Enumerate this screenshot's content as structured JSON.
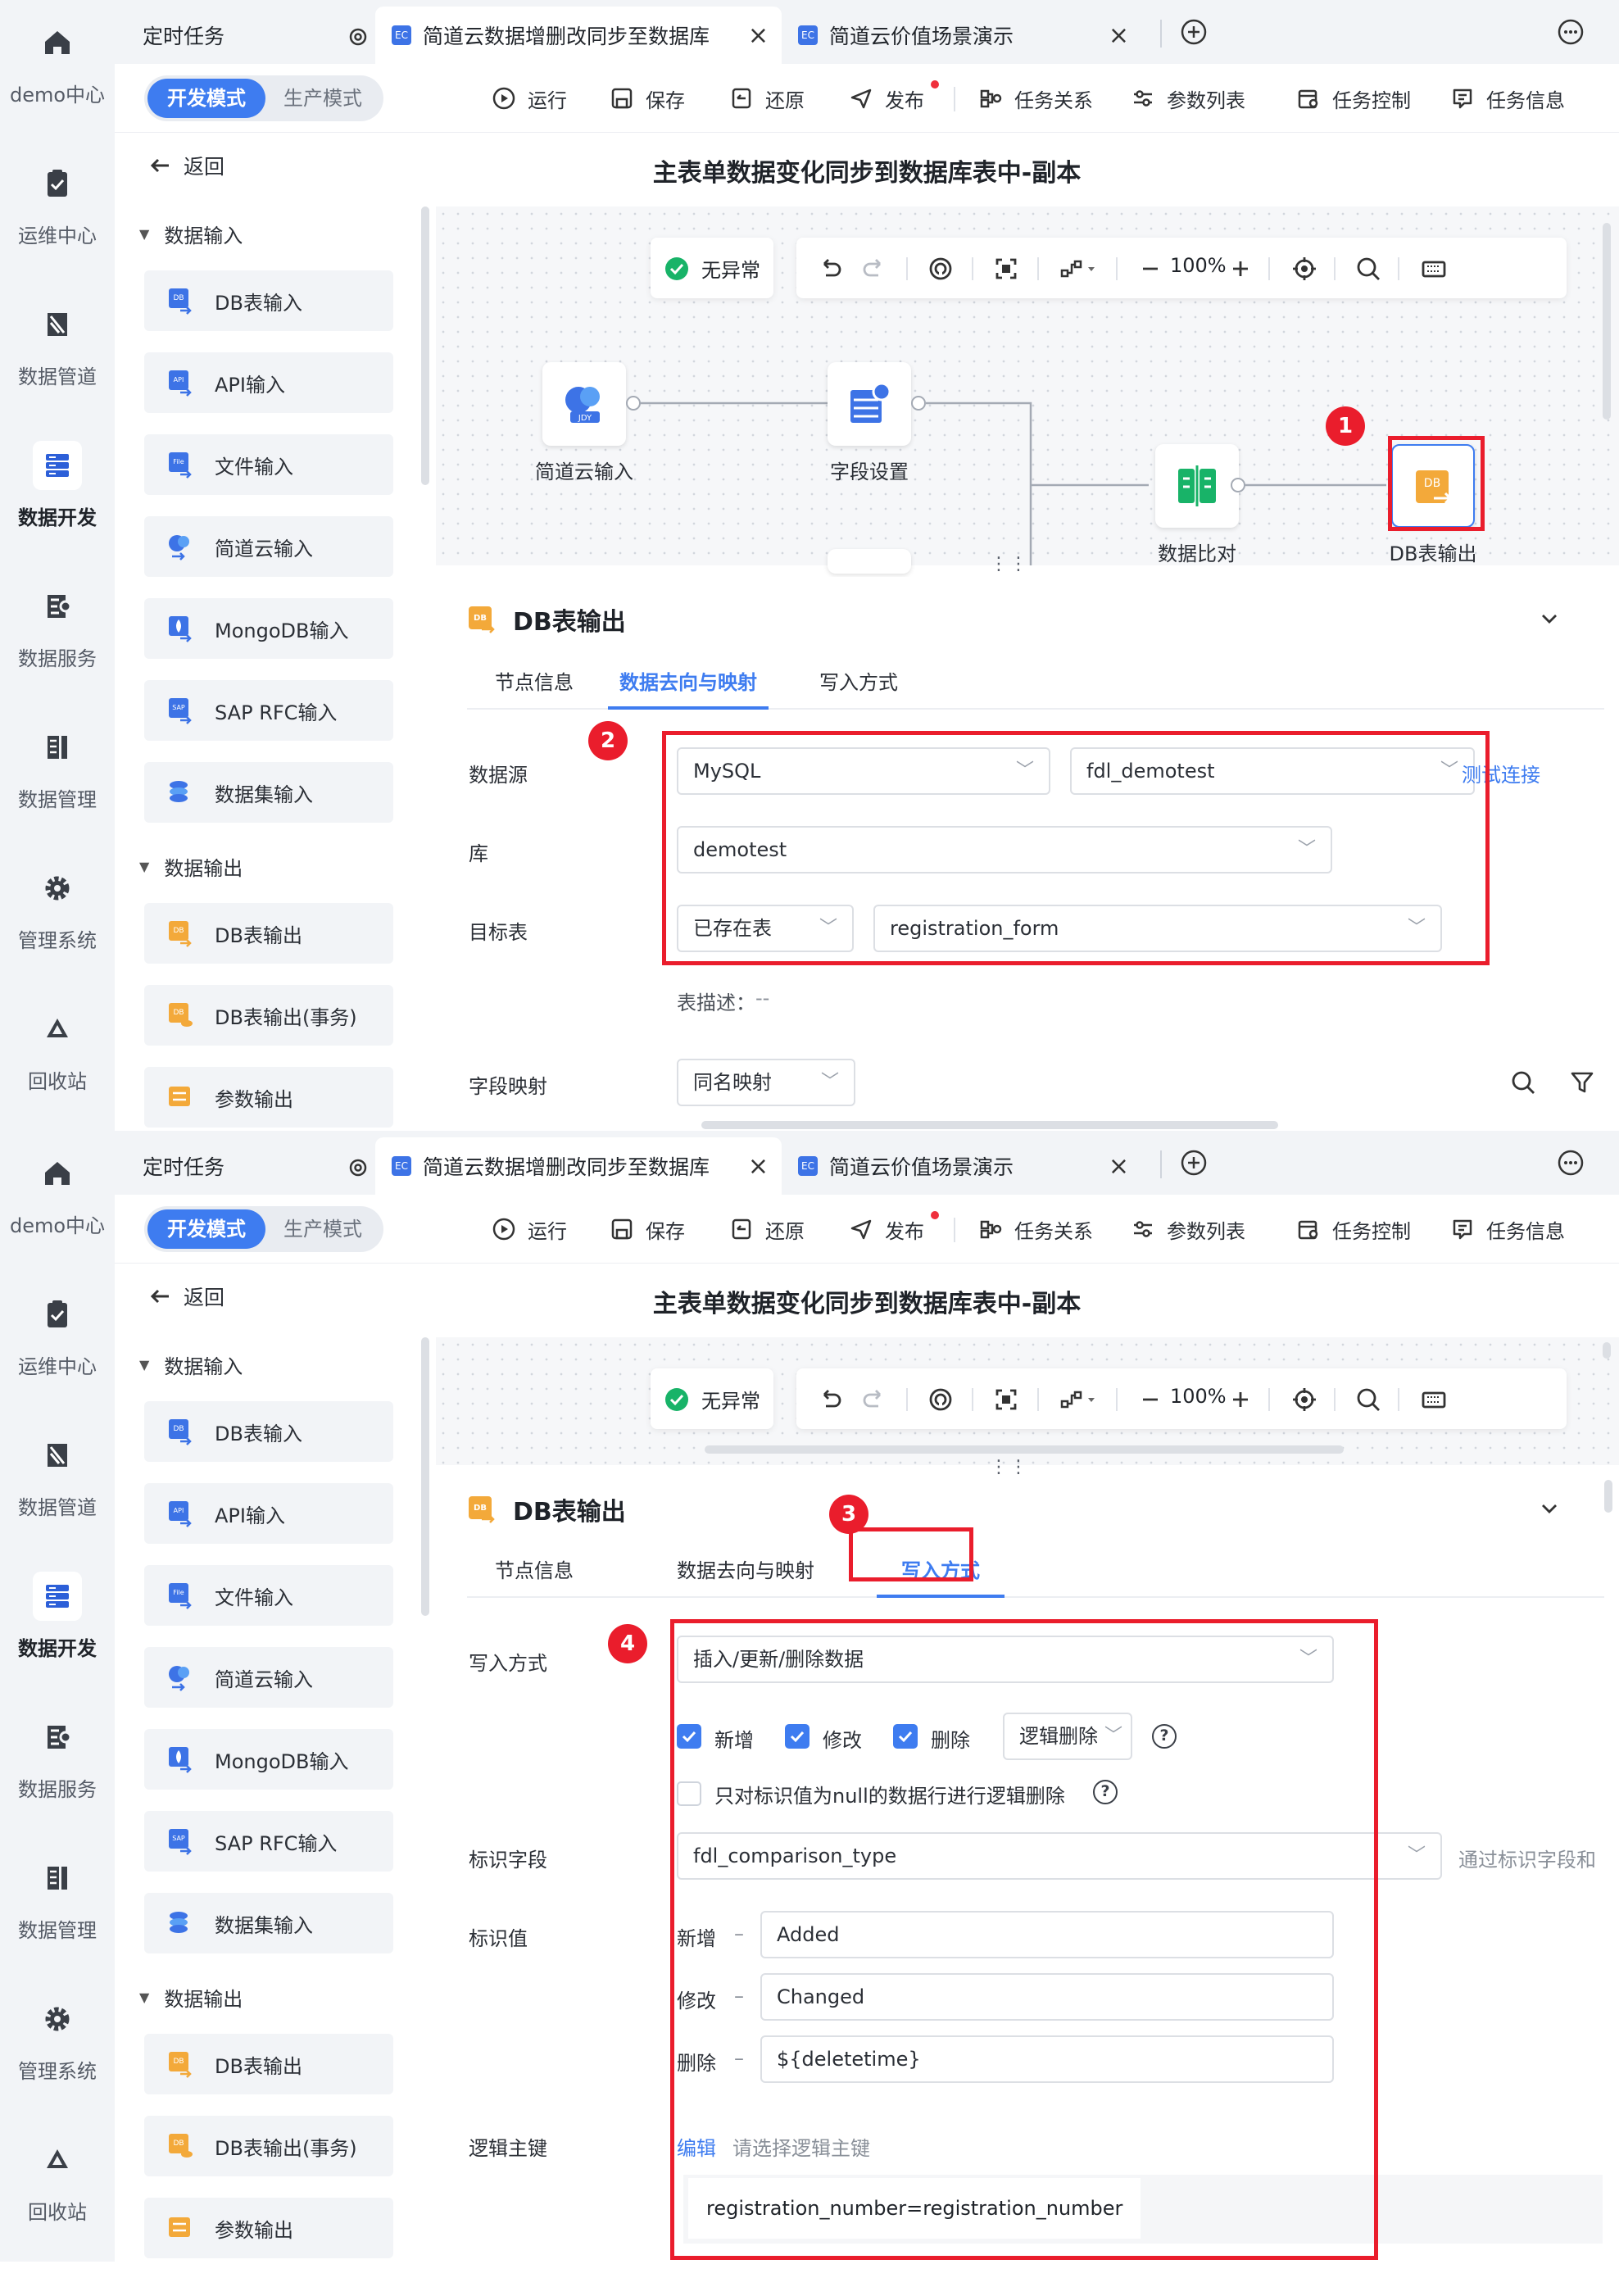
{
  "nav": [
    {
      "label": "demo中心",
      "icon": "home-icon"
    },
    {
      "label": "运维中心",
      "icon": "clipboard-check-icon"
    },
    {
      "label": "数据管道",
      "icon": "pipeline-icon"
    },
    {
      "label": "数据开发",
      "icon": "server-stack-icon"
    },
    {
      "label": "数据服务",
      "icon": "service-icon"
    },
    {
      "label": "数据管理",
      "icon": "data-management-icon"
    },
    {
      "label": "管理系统",
      "icon": "gear-icon"
    },
    {
      "label": "回收站",
      "icon": "recycle-bin-icon"
    }
  ],
  "tabs": {
    "scheduled": "定时任务",
    "tab1": "简道云数据增删改同步至数据库",
    "tab2": "简道云价值场景演示"
  },
  "modes": {
    "dev": "开发模式",
    "prod": "生产模式"
  },
  "toolbar": {
    "run": "运行",
    "save": "保存",
    "restore": "还原",
    "publish": "发布",
    "relations": "任务关系",
    "params": "参数列表",
    "control": "任务控制",
    "info": "任务信息"
  },
  "back": "返回",
  "page_title": "主表单数据变化同步到数据库表中-副本",
  "left_panel": {
    "input_group": "数据输入",
    "inputs": [
      "DB表输入",
      "API输入",
      "文件输入",
      "简道云输入",
      "MongoDB输入",
      "SAP RFC输入",
      "数据集输入"
    ],
    "output_group": "数据输出",
    "outputs": [
      "DB表输出",
      "DB表输出(事务)",
      "参数输出"
    ]
  },
  "canvas": {
    "status": "无异常",
    "zoom": "100%",
    "nodes": {
      "jdy_input": "简道云输入",
      "field_settings": "字段设置",
      "data_compare": "数据比对",
      "db_output": "DB表输出"
    }
  },
  "property": {
    "title": "DB表输出",
    "tabs": [
      "节点信息",
      "数据去向与映射",
      "写入方式"
    ]
  },
  "mapping": {
    "datasource_label": "数据源",
    "datasource_type": "MySQL",
    "connection": "fdl_demotest",
    "test_connection": "测试连接",
    "db_label": "库",
    "db": "demotest",
    "target_label": "目标表",
    "table_mode": "已存在表",
    "table": "registration_form",
    "table_desc_label": "表描述：",
    "table_desc": "--",
    "field_mapping_label": "字段映射",
    "field_mapping": "同名映射"
  },
  "write": {
    "mode_label": "写入方式",
    "mode": "插入/更新/删除数据",
    "insert": "新增",
    "update": "修改",
    "delete": "删除",
    "delete_mode": "逻辑删除",
    "null_only": "只对标识值为null的数据行进行逻辑删除",
    "flag_field_label": "标识字段",
    "flag_field": "fdl_comparison_type",
    "flag_hint": "通过标识字段和",
    "flag_value_label": "标识值",
    "insert_value": "Added",
    "update_value": "Changed",
    "delete_value": "${deletetime}",
    "dash": "–",
    "logic_key_label": "逻辑主键",
    "edit": "编辑",
    "logic_key_placeholder": "请选择逻辑主键",
    "logic_key": "registration_number=registration_number"
  },
  "badges": [
    "1",
    "2",
    "3",
    "4"
  ],
  "colors": {
    "accent": "#3e7cf0",
    "highlight": "#ea1d2c",
    "success": "#18b368",
    "db_output": "#f3a93a"
  }
}
